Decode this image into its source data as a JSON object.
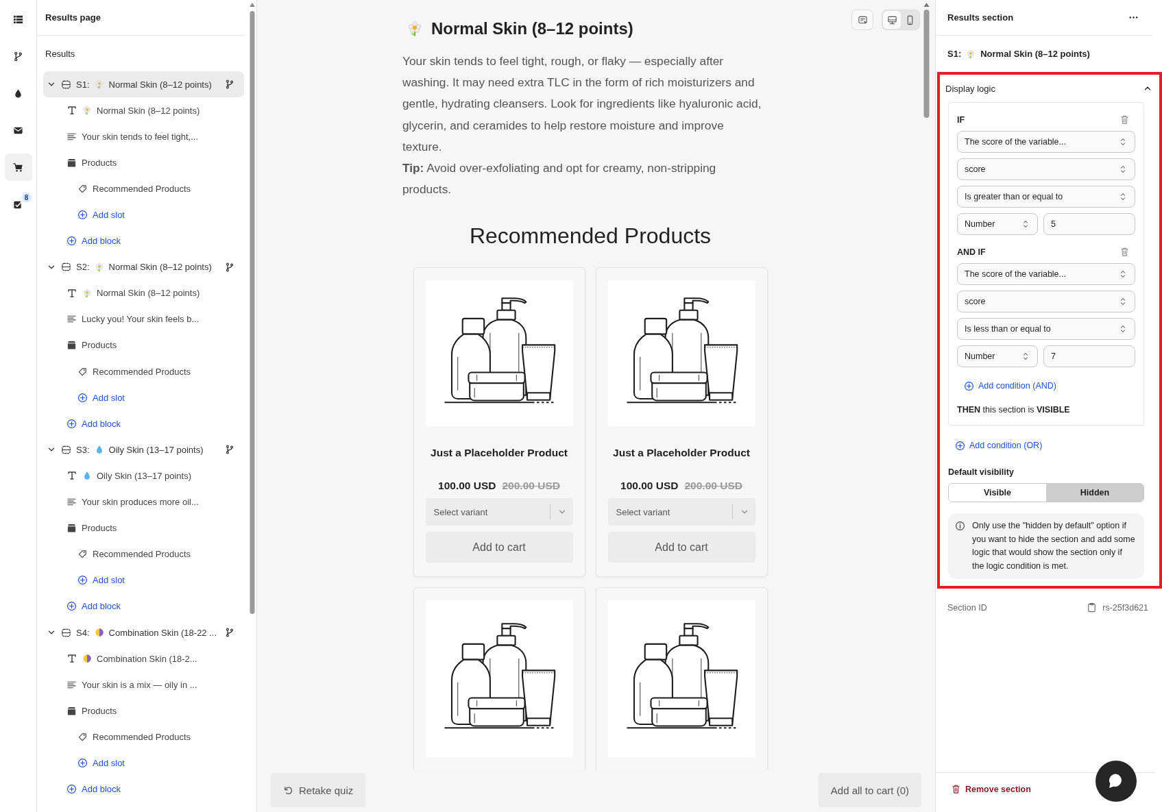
{
  "rail": {
    "items": [
      {
        "kind": "list",
        "selected": false
      },
      {
        "kind": "branch",
        "selected": false
      },
      {
        "kind": "drop",
        "selected": false
      },
      {
        "kind": "mail",
        "selected": false
      },
      {
        "kind": "cart",
        "selected": true
      },
      {
        "kind": "tasks",
        "selected": false,
        "badge": "8"
      }
    ]
  },
  "outline": {
    "title": "Results page",
    "root": "Results",
    "sections": [
      {
        "prefix": "S1:",
        "kind": "flower",
        "label": "Normal Skin (8–12 points)",
        "selected": true,
        "expanded": true,
        "children": [
          {
            "kind": "heading",
            "label": "Normal Skin (8–12 points)"
          },
          {
            "kind": "text",
            "label": "Your skin tends to feel tight,..."
          },
          {
            "kind": "products",
            "label": "Products",
            "children": [
              {
                "kind": "slot",
                "label": "Recommended Products"
              },
              {
                "kind": "add",
                "label": "Add slot"
              }
            ]
          },
          {
            "kind": "add",
            "label": "Add block"
          }
        ]
      },
      {
        "prefix": "S2:",
        "kind": "flower",
        "label": "Normal Skin (8–12 points)",
        "selected": false,
        "expanded": true,
        "children": [
          {
            "kind": "heading",
            "label": "Normal Skin (8–12 points)"
          },
          {
            "kind": "text",
            "label": "Lucky you! Your skin feels b..."
          },
          {
            "kind": "products",
            "label": "Products",
            "children": [
              {
                "kind": "slot",
                "label": "Recommended Products"
              },
              {
                "kind": "add",
                "label": "Add slot"
              }
            ]
          },
          {
            "kind": "add",
            "label": "Add block"
          }
        ]
      },
      {
        "prefix": "S3:",
        "kind": "drop",
        "label": "Oily Skin (13–17 points)",
        "selected": false,
        "expanded": true,
        "children": [
          {
            "kind": "heading",
            "label": "Oily Skin (13–17 points)"
          },
          {
            "kind": "text",
            "label": "Your skin produces more oil..."
          },
          {
            "kind": "products",
            "label": "Products",
            "children": [
              {
                "kind": "slot",
                "label": "Recommended Products"
              },
              {
                "kind": "add",
                "label": "Add slot"
              }
            ]
          },
          {
            "kind": "add",
            "label": "Add block"
          }
        ]
      },
      {
        "prefix": "S4:",
        "kind": "half",
        "label": "Combination Skin (18-22 ...",
        "selected": false,
        "expanded": true,
        "children": [
          {
            "kind": "heading",
            "label": "Combination Skin (18-2..."
          },
          {
            "kind": "text",
            "label": "Your skin is a mix — oily in ..."
          },
          {
            "kind": "products",
            "label": "Products",
            "children": [
              {
                "kind": "slot",
                "label": "Recommended Products"
              },
              {
                "kind": "add",
                "label": "Add slot"
              }
            ]
          },
          {
            "kind": "add",
            "label": "Add block"
          }
        ]
      }
    ]
  },
  "preview": {
    "devices": [
      {
        "kind": "desktop",
        "selected": true
      },
      {
        "kind": "mobile",
        "selected": false
      }
    ],
    "title": "Normal Skin (8–12 points)",
    "paragraphs": [
      "Your skin tends to feel tight, rough, or flaky — especially after washing. It may need extra TLC in the form of rich moisturizers and gentle, hydrating cleansers. Look for ingredients like hyaluronic acid, glycerin, and ceramides to help restore moisture and improve texture.",
      "**Tip:** Avoid over-exfoliating and opt for creamy, non-stripping products."
    ],
    "products_title": "Recommended Products",
    "products": [
      {
        "kind": "full",
        "title": "Just a Placeholder Product",
        "price": "100.00 USD",
        "compare_price": "200.00 USD",
        "placeholder": "Select variant",
        "button": "Add to cart"
      },
      {
        "kind": "full",
        "title": "Just a Placeholder Product",
        "price": "100.00 USD",
        "compare_price": "200.00 USD",
        "placeholder": "Select variant",
        "button": "Add to cart"
      },
      {
        "kind": "cut"
      },
      {
        "kind": "cut"
      }
    ],
    "retake": "Retake quiz",
    "cart": "Add all to cart (0)"
  },
  "inspector": {
    "title": "Results section",
    "section": {
      "prefix": "S1:",
      "label": "Normal Skin (8–12 points)"
    },
    "display_logic": {
      "title": "Display logic",
      "expanded": true,
      "groups": [
        {
          "label": "IF",
          "selects": [
            "The score of the variable...",
            "score",
            "Is greater than or equal to"
          ],
          "value_type": "Number",
          "value": "5"
        },
        {
          "label": "AND IF",
          "selects": [
            "The score of the variable...",
            "score",
            "Is less than or equal to"
          ],
          "value_type": "Number",
          "value": "7"
        }
      ],
      "add_and": "Add condition (AND)",
      "then": "**THEN** this section is **VISIBLE**",
      "add_or": "Add condition (OR)",
      "default_visibility": {
        "label": "Default visibility",
        "options": [
          {
            "label": "Visible",
            "selected": false
          },
          {
            "label": "Hidden",
            "selected": true
          }
        ]
      },
      "note": "Only use the \"hidden by default\" option if you want to hide the section and add some logic that would show the section only if the logic condition is met."
    },
    "section_id": {
      "label": "Section ID",
      "value": "rs-25f3d621"
    },
    "remove": "Remove section"
  }
}
